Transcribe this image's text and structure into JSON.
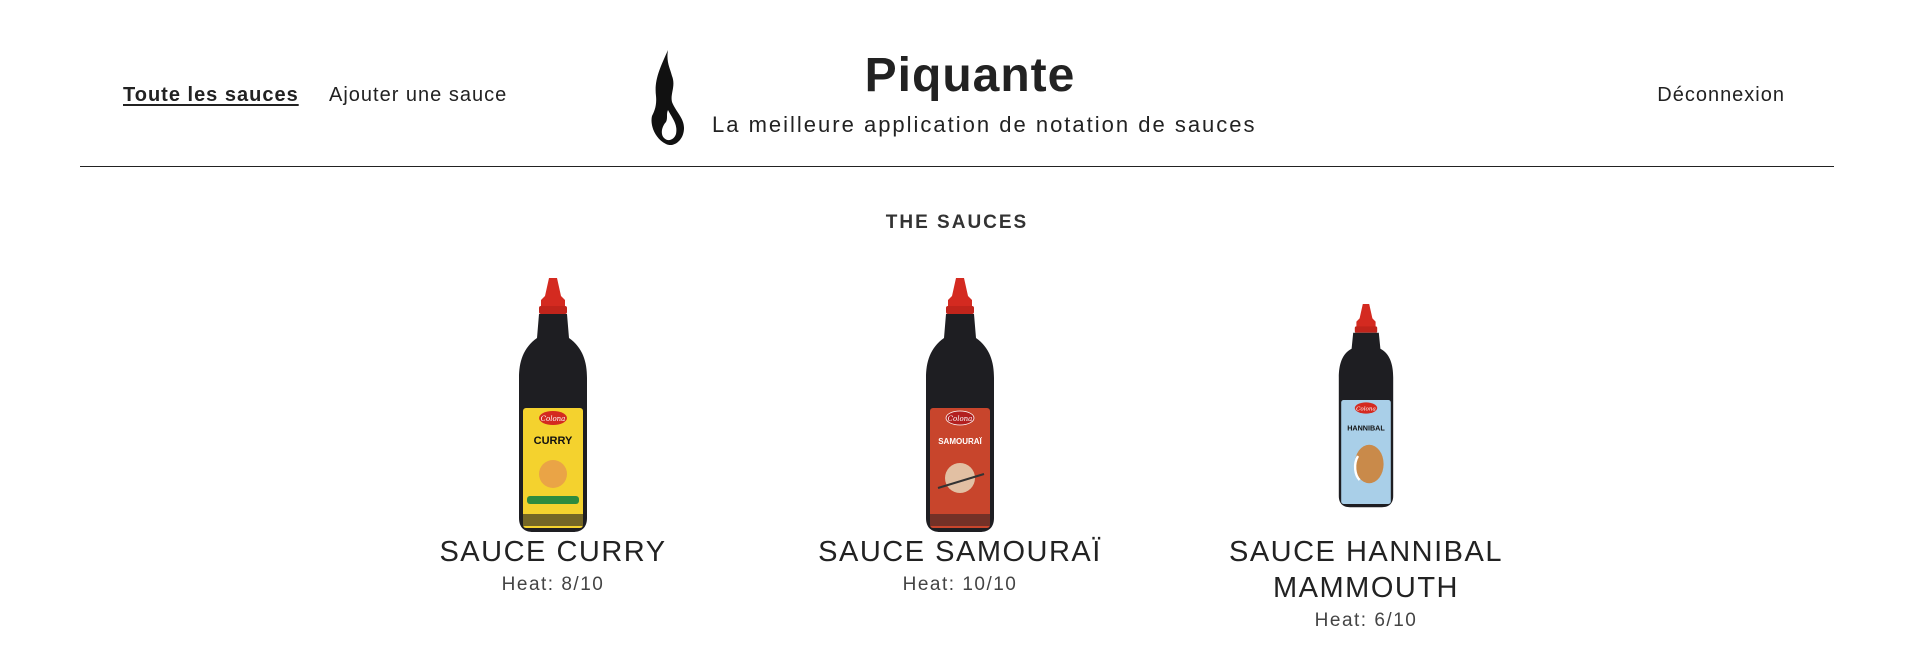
{
  "nav": {
    "all_sauces": "Toute les sauces",
    "add_sauce": "Ajouter une sauce",
    "logout": "Déconnexion"
  },
  "brand": {
    "title": "Piquante",
    "subtitle": "La meilleure application de notation de sauces",
    "icon": "flame-icon"
  },
  "section_title": "THE SAUCES",
  "sauces": [
    {
      "name": "SAUCE CURRY",
      "heat": "Heat: 8/10",
      "label_color": "#f4d22e",
      "label_text": "CURRY",
      "brand": "Colona"
    },
    {
      "name": "SAUCE SAMOURAÏ",
      "heat": "Heat: 10/10",
      "label_color": "#c8452c",
      "label_text": "SAMOURAÏ",
      "brand": "Colona"
    },
    {
      "name": "SAUCE HANNIBAL MAMMOUTH",
      "heat": "Heat: 6/10",
      "label_color": "#a9cfe8",
      "label_text": "HANNIBAL",
      "brand": "Colona"
    }
  ],
  "colors": {
    "text": "#222222",
    "bottle": "#1e1e22",
    "cap": "#d42a20"
  }
}
